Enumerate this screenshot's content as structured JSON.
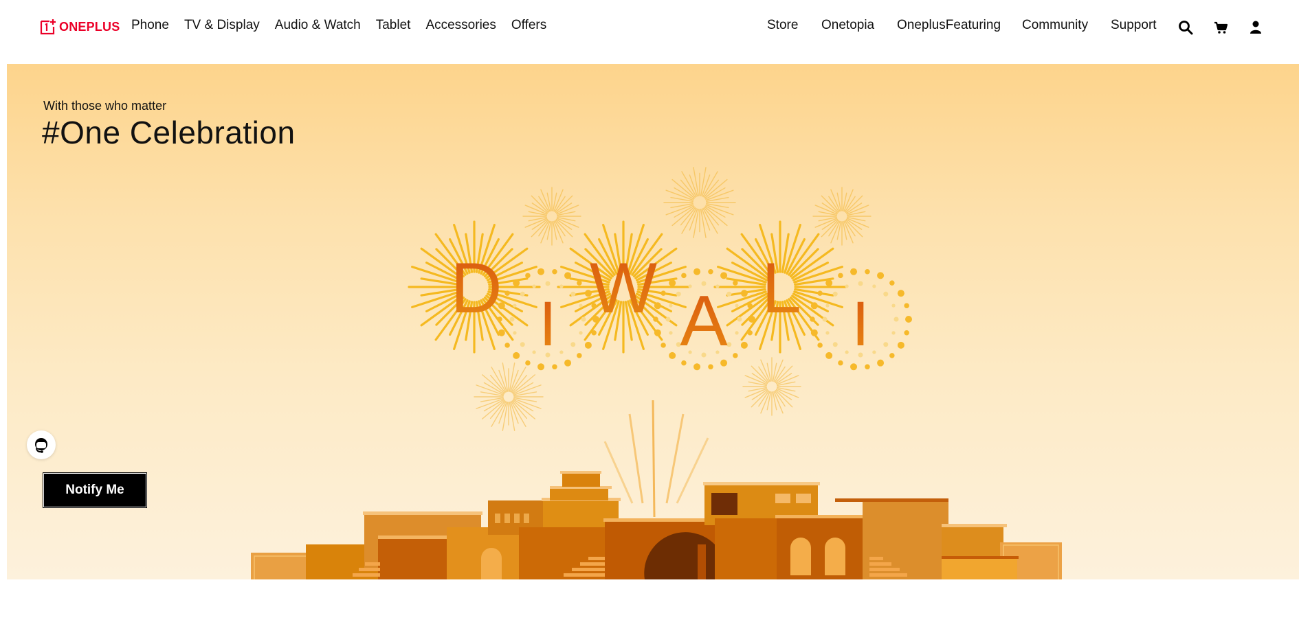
{
  "brand": {
    "name": "ONEPLUS",
    "color": "#eb0028"
  },
  "nav_left": [
    {
      "label": "Phone"
    },
    {
      "label": "TV & Display"
    },
    {
      "label": "Audio & Watch"
    },
    {
      "label": "Tablet"
    },
    {
      "label": "Accessories"
    },
    {
      "label": "Offers"
    }
  ],
  "nav_right": [
    {
      "label": "Store"
    },
    {
      "label": "Onetopia"
    },
    {
      "label": "OneplusFeaturing"
    },
    {
      "label": "Community"
    },
    {
      "label": "Support"
    }
  ],
  "icons": {
    "search": "search-icon",
    "cart": "cart-icon",
    "account": "user-icon",
    "support": "headset-icon"
  },
  "hero": {
    "subtitle": "With those who matter",
    "title": "#One Celebration",
    "banner_letters": [
      "D",
      "I",
      "W",
      "A",
      "L",
      "I"
    ],
    "cta_label": "Notify Me"
  }
}
